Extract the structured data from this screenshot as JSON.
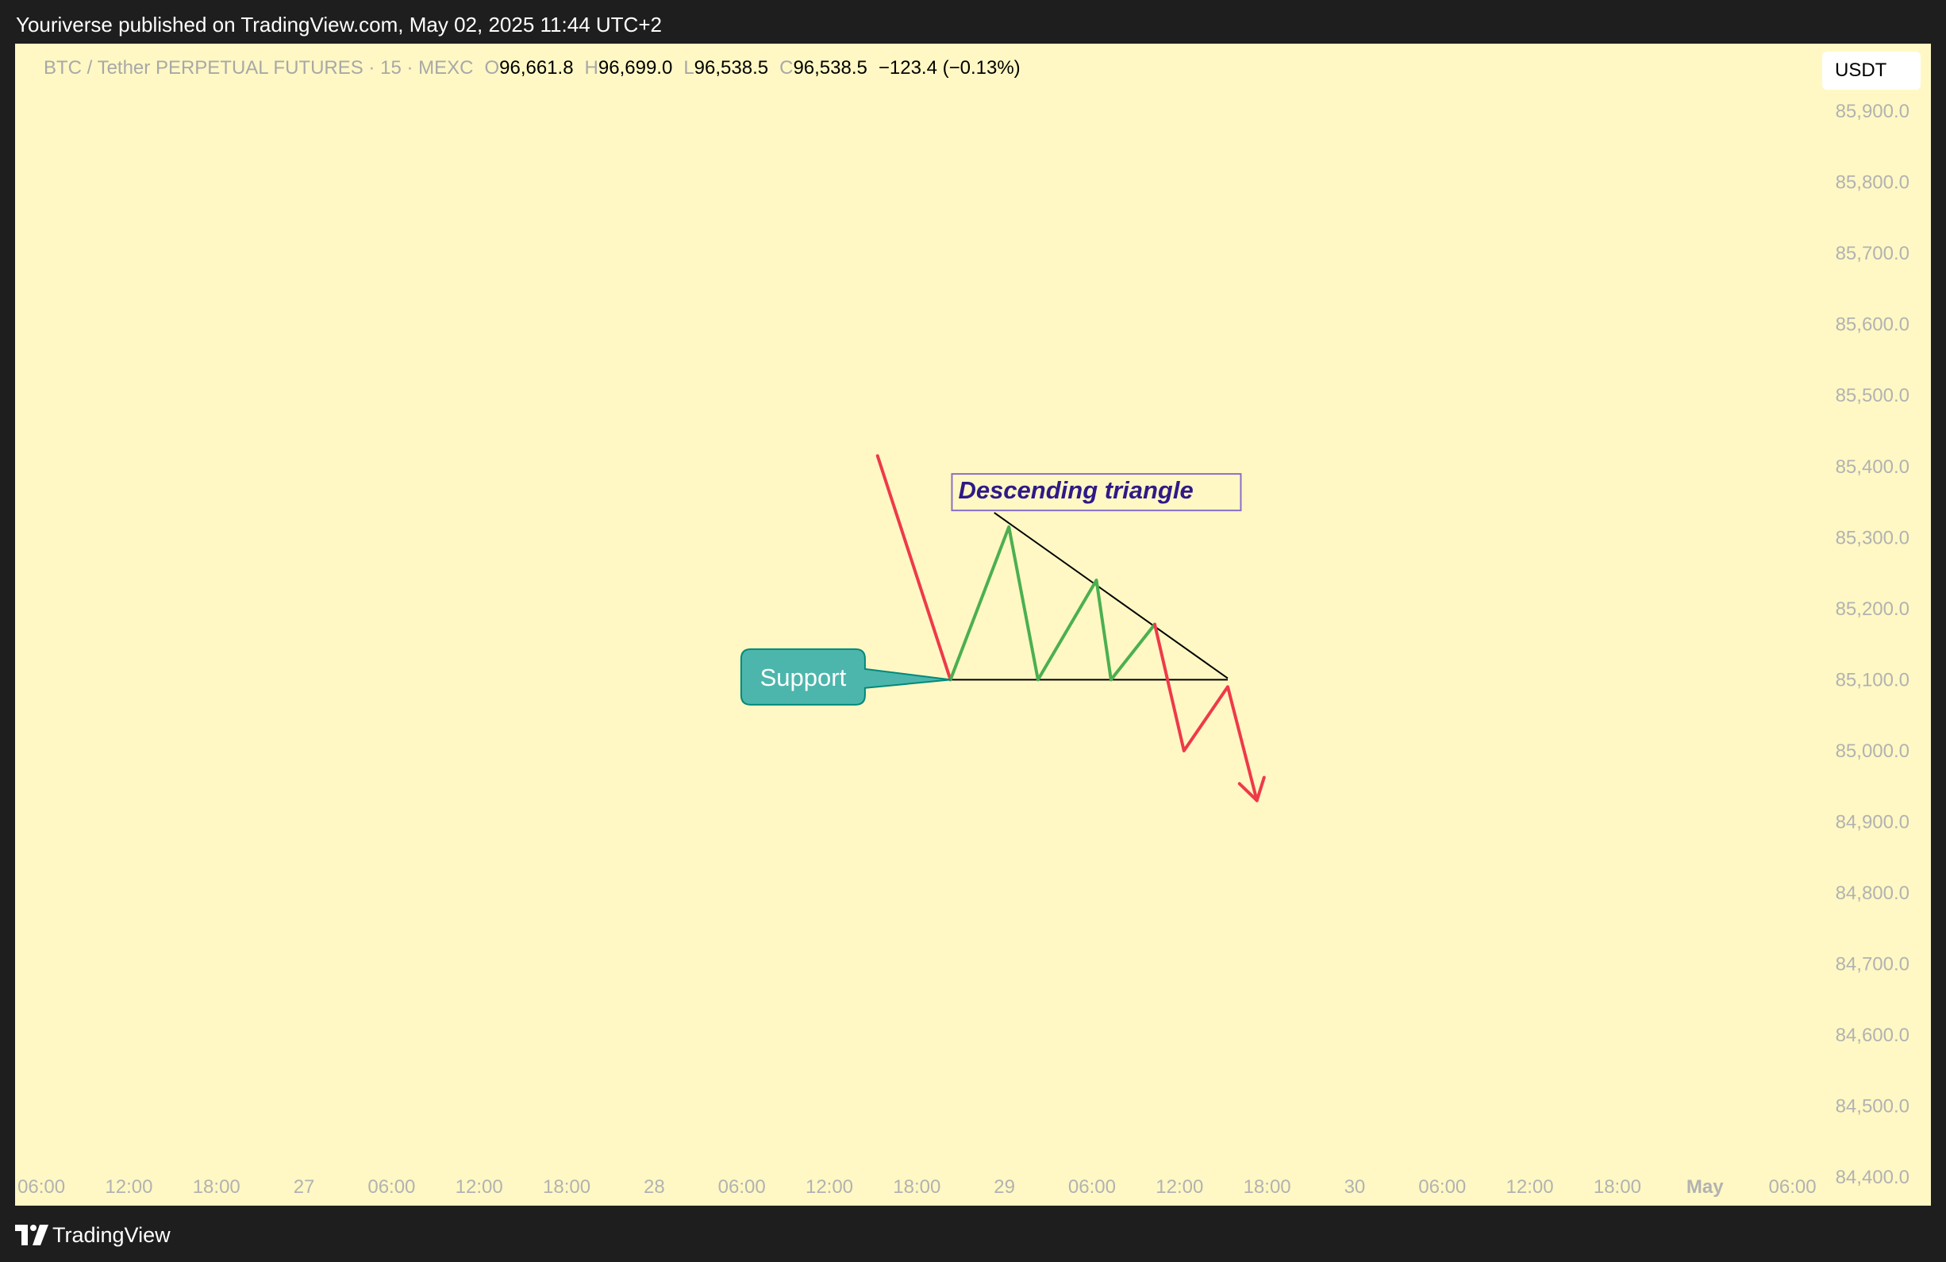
{
  "header": {
    "published_text": "Youriverse published on TradingView.com, May 02, 2025 11:44 UTC+2"
  },
  "legend": {
    "symbol": "BTC / Tether PERPETUAL FUTURES · 15 · MEXC",
    "o_label": "O",
    "o_value": "96,661.8",
    "h_label": "H",
    "h_value": "96,699.0",
    "l_label": "L",
    "l_value": "96,538.5",
    "c_label": "C",
    "c_value": "96,538.5",
    "change": "−123.4 (−0.13%)"
  },
  "price_axis": {
    "unit": "USDT"
  },
  "footer": {
    "brand": "TradingView"
  },
  "colors": {
    "background": "#fff8c4",
    "frame": "#1e1e1e",
    "bearish": "#ee3a4a",
    "bullish": "#4caf50",
    "trendline": "#000000",
    "label_text": "#2e1a87",
    "label_border": "#8a6fc7",
    "callout_fill": "#4db6ac",
    "callout_border": "#00897b",
    "axis_text": "#b2b2b2"
  },
  "chart_data": {
    "type": "line",
    "title": "",
    "y_ticks": [
      "85,900.0",
      "85,800.0",
      "85,700.0",
      "85,600.0",
      "85,500.0",
      "85,400.0",
      "85,300.0",
      "85,200.0",
      "85,100.0",
      "85,000.0",
      "84,900.0",
      "84,800.0",
      "84,700.0",
      "84,600.0",
      "84,500.0",
      "84,400.0"
    ],
    "y_tick_values": [
      85900,
      85800,
      85700,
      85600,
      85500,
      85400,
      85300,
      85200,
      85100,
      85000,
      84900,
      84800,
      84700,
      84600,
      84500,
      84400
    ],
    "ylim": [
      84360,
      85995
    ],
    "x_ticks": [
      "06:00",
      "12:00",
      "18:00",
      "27",
      "06:00",
      "12:00",
      "18:00",
      "28",
      "06:00",
      "12:00",
      "18:00",
      "29",
      "06:00",
      "12:00",
      "18:00",
      "30",
      "06:00",
      "12:00",
      "18:00",
      "May",
      "06:00"
    ],
    "x_tick_bold": [
      false,
      false,
      false,
      false,
      false,
      false,
      false,
      false,
      false,
      false,
      false,
      false,
      false,
      false,
      false,
      false,
      false,
      false,
      false,
      true,
      false
    ],
    "x_tick_hours": [
      6,
      12,
      18,
      24,
      30,
      36,
      42,
      48,
      54,
      60,
      66,
      72,
      78,
      84,
      90,
      96,
      102,
      108,
      114,
      120,
      126
    ],
    "xlim": [
      4.2,
      128.2
    ],
    "grid": false,
    "series": [
      {
        "role": "bearish-drop",
        "color": "#ee3a4a",
        "points": [
          [
            63.3,
            85415
          ],
          [
            68.3,
            85100
          ]
        ]
      },
      {
        "role": "bullish-zigzag",
        "color": "#4caf50",
        "points": [
          [
            68.3,
            85100
          ],
          [
            72.3,
            85315
          ],
          [
            74.3,
            85100
          ],
          [
            78.3,
            85240
          ],
          [
            79.3,
            85100
          ],
          [
            82.3,
            85178
          ]
        ]
      },
      {
        "role": "bearish-breakdown",
        "color": "#ee3a4a",
        "points": [
          [
            82.3,
            85178
          ],
          [
            84.3,
            85000
          ],
          [
            87.3,
            85090
          ],
          [
            89.3,
            84930
          ]
        ]
      }
    ],
    "trendlines": [
      {
        "name": "resistance",
        "points": [
          [
            71.3,
            85335
          ],
          [
            87.3,
            85102
          ]
        ]
      },
      {
        "name": "support",
        "points": [
          [
            68.3,
            85100
          ],
          [
            87.3,
            85100
          ]
        ]
      }
    ],
    "arrowhead": {
      "at": [
        89.3,
        84930
      ],
      "from": [
        87.3,
        85090
      ]
    },
    "annotations": [
      {
        "text": "Descending triangle",
        "anchor": [
          68.4,
          85365
        ],
        "style": "box-label"
      },
      {
        "text": "Support",
        "anchor": [
          58.2,
          85104
        ],
        "pointer": [
          68.3,
          85100
        ],
        "style": "callout"
      }
    ]
  }
}
